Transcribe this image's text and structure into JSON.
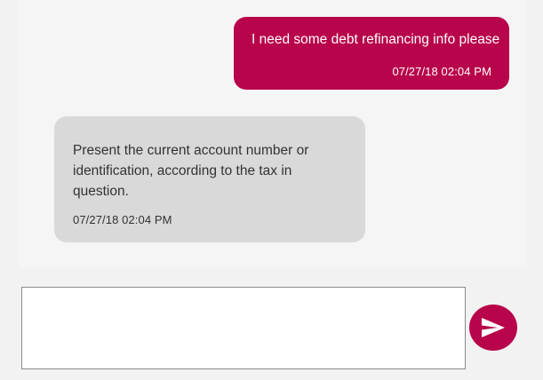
{
  "colors": {
    "accent": "#b8044a",
    "bot_bubble": "#d9d9d9",
    "background": "#f2f2f2"
  },
  "conversation": {
    "messages": [
      {
        "sender": "user",
        "text": "I need some debt refinancing info please",
        "time": "07/27/18 02:04 PM"
      },
      {
        "sender": "bot",
        "text": "Present the current account number or identification, according to the tax in question.",
        "time": "07/27/18 02:04 PM"
      }
    ]
  },
  "composer": {
    "value": "",
    "placeholder": ""
  },
  "send_button": {
    "icon": "send-icon"
  }
}
